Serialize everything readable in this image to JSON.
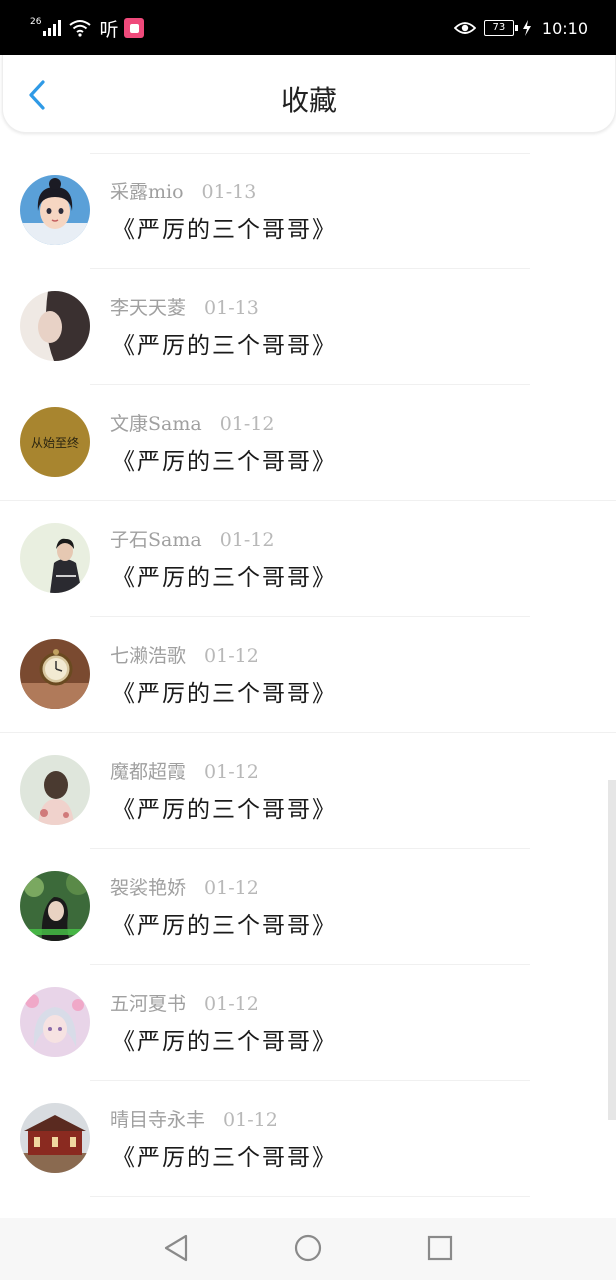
{
  "status_bar": {
    "network": "26",
    "listen_label": "听",
    "battery": "73",
    "time": "10:10"
  },
  "header": {
    "title": "收藏",
    "back_icon": "chevron-left-icon",
    "accent_color": "#2f9ae6"
  },
  "entries": [
    {
      "user": "采露mio",
      "date": "01-13",
      "title": "《严厉的三个哥哥》"
    },
    {
      "user": "李天天菱",
      "date": "01-13",
      "title": "《严厉的三个哥哥》"
    },
    {
      "user": "文康Sama",
      "date": "01-12",
      "title": "《严厉的三个哥哥》",
      "avatar_text": "从始至终"
    },
    {
      "user": "子石Sama",
      "date": "01-12",
      "title": "《严厉的三个哥哥》"
    },
    {
      "user": "七濑浩歌",
      "date": "01-12",
      "title": "《严厉的三个哥哥》"
    },
    {
      "user": "魔都超霞",
      "date": "01-12",
      "title": "《严厉的三个哥哥》"
    },
    {
      "user": "袈裟艳娇",
      "date": "01-12",
      "title": "《严厉的三个哥哥》"
    },
    {
      "user": "五河夏书",
      "date": "01-12",
      "title": "《严厉的三个哥哥》"
    },
    {
      "user": "晴目寺永丰",
      "date": "01-12",
      "title": "《严厉的三个哥哥》"
    }
  ],
  "nav_bar": {
    "back": "triangle-back-icon",
    "home": "circle-home-icon",
    "recents": "square-recents-icon"
  }
}
